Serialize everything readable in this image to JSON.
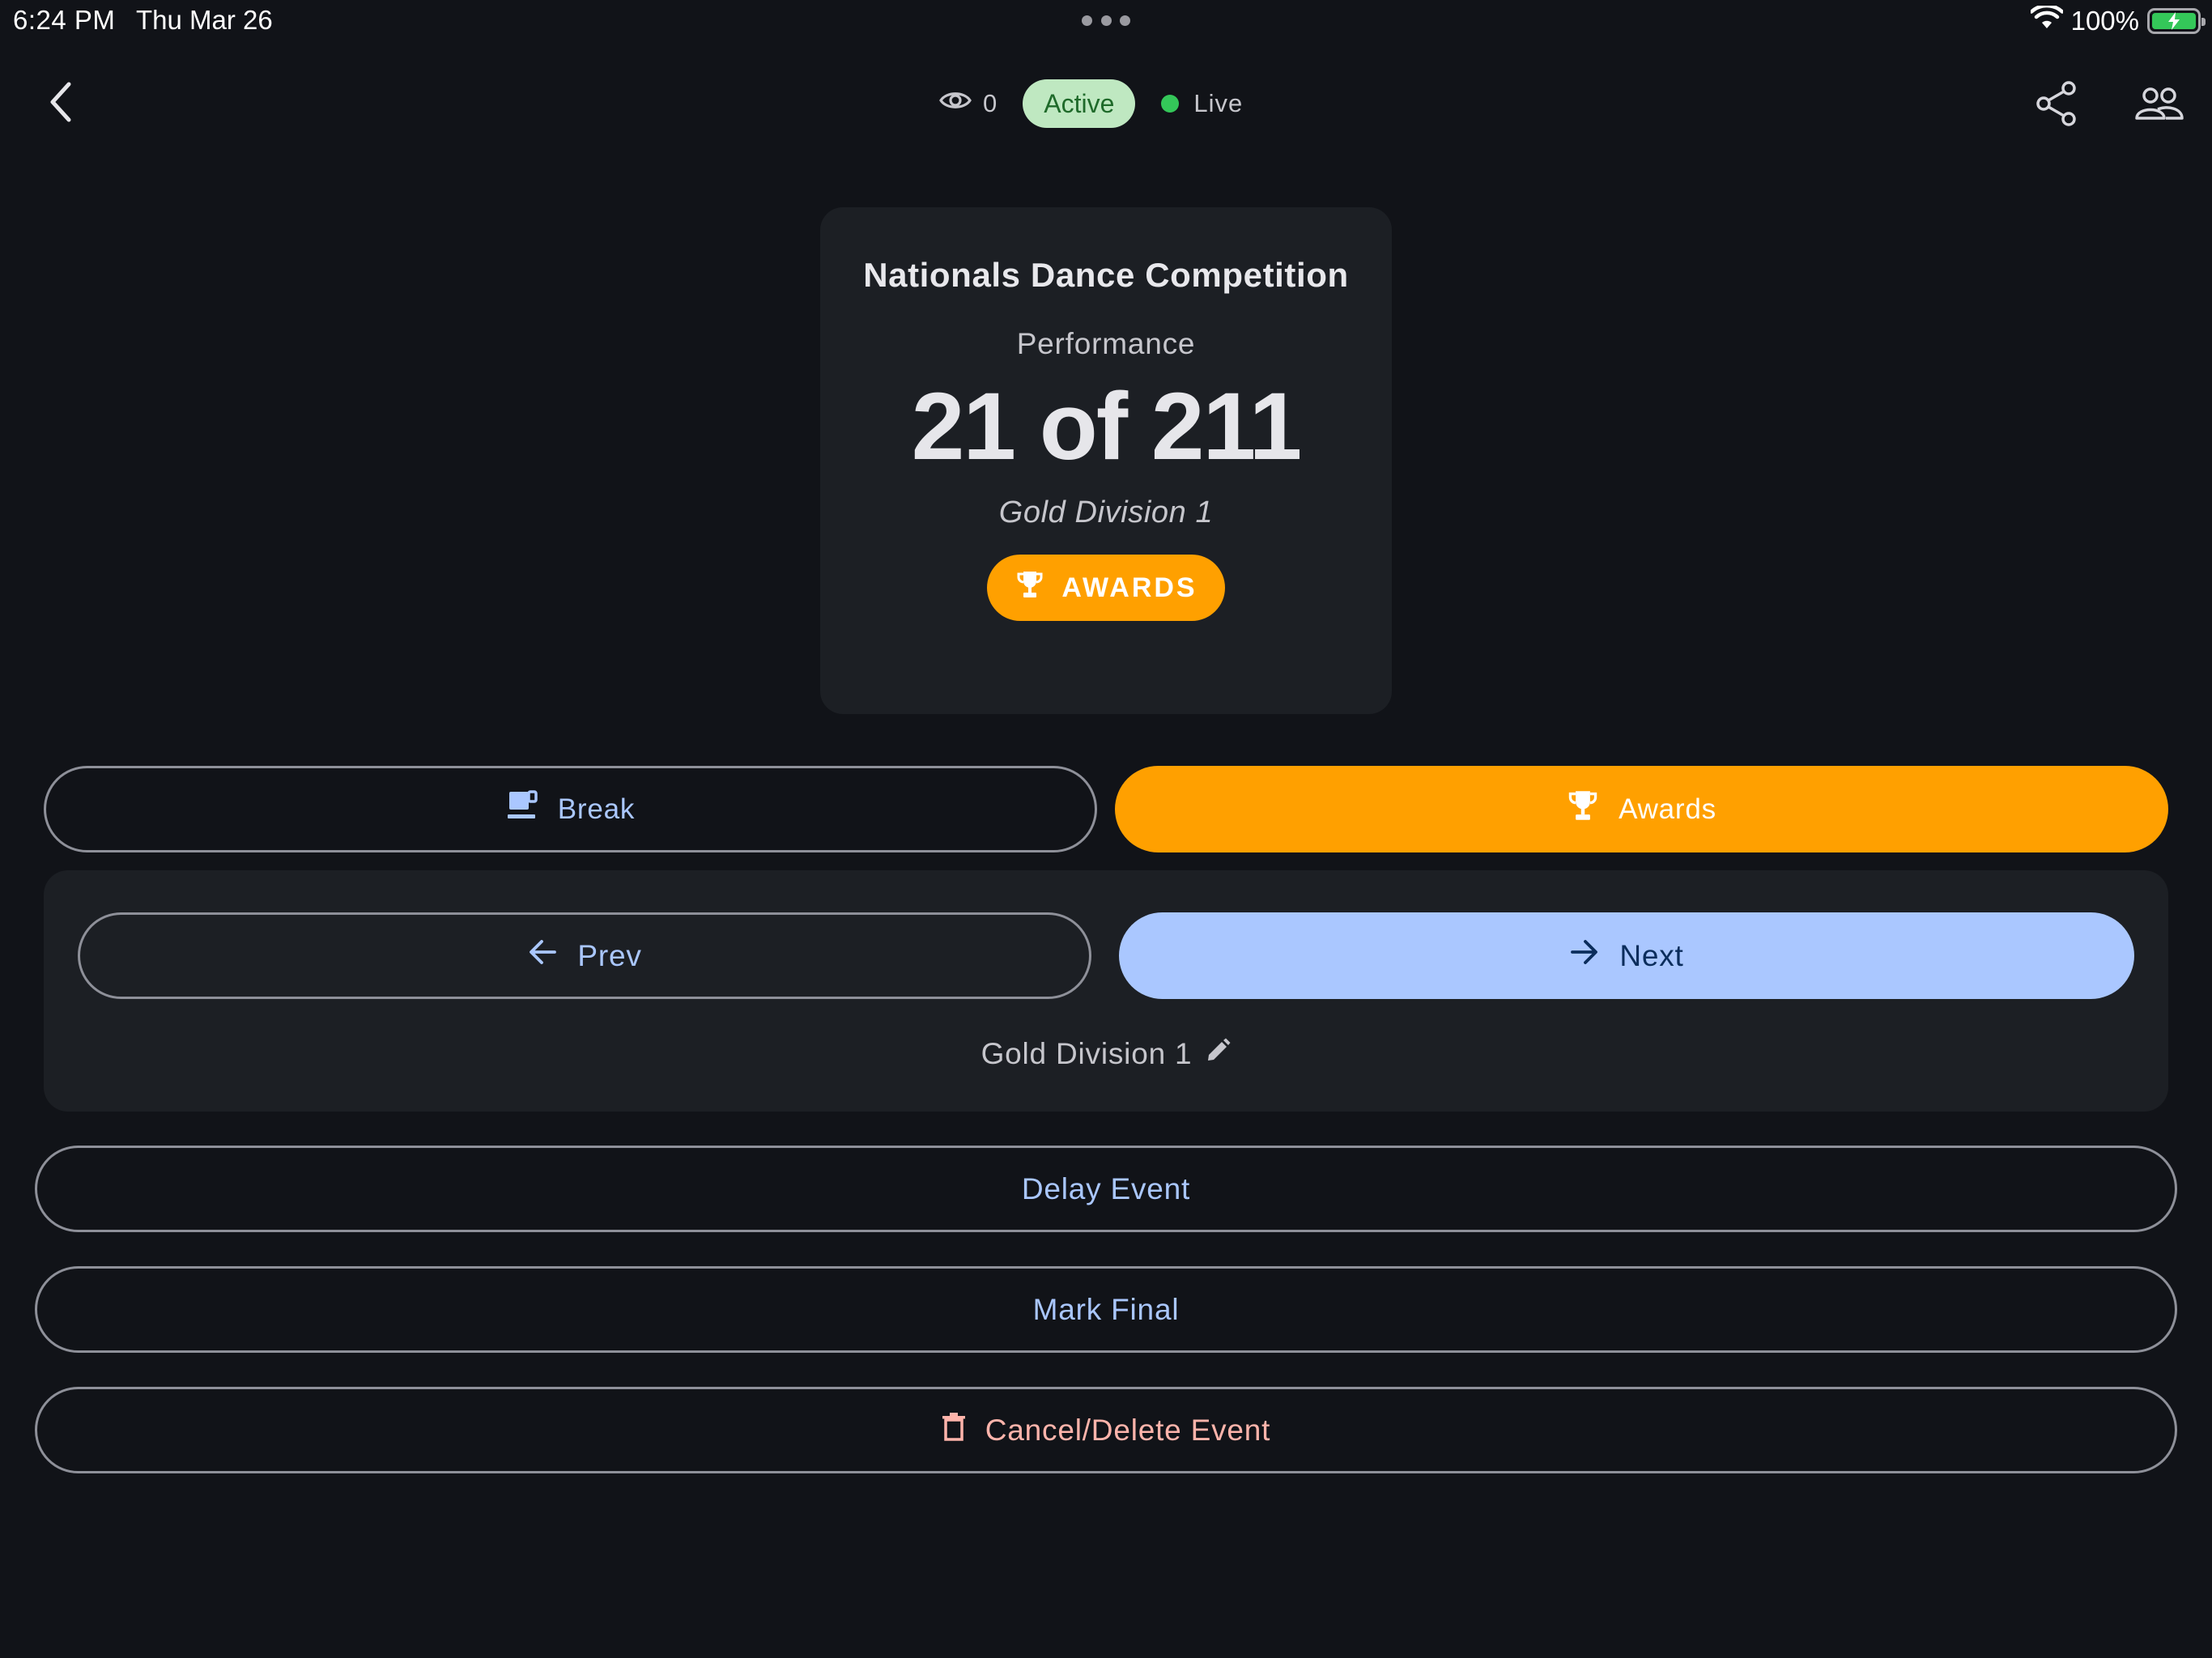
{
  "status_bar": {
    "time": "6:24 PM",
    "date": "Thu Mar 26",
    "battery": "100%",
    "icons": [
      "wifi-icon",
      "battery-charging-icon"
    ]
  },
  "header": {
    "viewer_count": "0",
    "status_badge": "Active",
    "live_label": "Live",
    "icons": [
      "back-arrow-icon",
      "eye-icon",
      "share-icon",
      "people-icon"
    ]
  },
  "card": {
    "event_name": "Nationals Dance Competition",
    "performance_label": "Performance",
    "performance_count": "21 of 211",
    "division": "Gold Division 1",
    "awards_chip": "AWARDS"
  },
  "actions": {
    "break_label": "Break",
    "awards_label": "Awards",
    "prev_label": "Prev",
    "next_label": "Next",
    "division_label": "Gold Division 1",
    "delay_label": "Delay Event",
    "final_label": "Mark Final",
    "cancel_label": "Cancel/Delete Event"
  },
  "colors": {
    "background": "#111318",
    "card": "#1c1f24",
    "accent_orange": "#ffa000",
    "accent_blue": "#aac7ff",
    "active_badge": "#bfe8c1",
    "live_dot": "#34c759",
    "danger": "#ffb4ab"
  }
}
